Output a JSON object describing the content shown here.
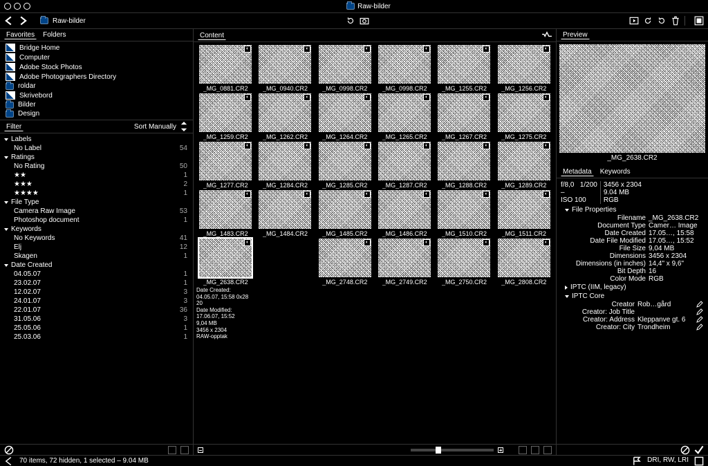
{
  "window_title": "Raw-bilder",
  "path_label": "Raw-bilder",
  "left": {
    "tabs": [
      "Favorites",
      "Folders"
    ],
    "fav_items": [
      {
        "label": "Bridge Home"
      },
      {
        "label": "Computer"
      },
      {
        "label": "Adobe Stock Photos"
      },
      {
        "label": "Adobe Photographers Directory"
      },
      {
        "label": "roldar"
      },
      {
        "label": "Skrivebord"
      },
      {
        "label": "Bilder"
      },
      {
        "label": "Design"
      }
    ],
    "filter_title": "Filter",
    "sort_label": "Sort Manually",
    "cats": [
      {
        "name": "Labels",
        "rows": [
          {
            "label": "No Label",
            "count": "54"
          }
        ]
      },
      {
        "name": "Ratings",
        "rows": [
          {
            "label": "No Rating",
            "count": "50"
          },
          {
            "label": "★★",
            "count": "1"
          },
          {
            "label": "★★★",
            "count": "2"
          },
          {
            "label": "★★★★",
            "count": "1"
          }
        ]
      },
      {
        "name": "File Type",
        "rows": [
          {
            "label": "Camera Raw Image",
            "count": "53"
          },
          {
            "label": "Photoshop document",
            "count": "1"
          }
        ]
      },
      {
        "name": "Keywords",
        "rows": [
          {
            "label": "No Keywords",
            "count": "41"
          },
          {
            "label": "Elj",
            "count": "12"
          },
          {
            "label": "Skagen",
            "count": "1"
          }
        ]
      },
      {
        "name": "Date Created",
        "rows": [
          {
            "label": "04.05.07",
            "count": "1"
          },
          {
            "label": "23.02.07",
            "count": "1"
          },
          {
            "label": "12.02.07",
            "count": "3"
          },
          {
            "label": "24.01.07",
            "count": "3"
          },
          {
            "label": "22.01.07",
            "count": "36"
          },
          {
            "label": "31.05.06",
            "count": "3"
          },
          {
            "label": "25.05.06",
            "count": "1"
          },
          {
            "label": "25.03.06",
            "count": "1"
          }
        ]
      }
    ]
  },
  "center": {
    "tab": "Content",
    "thumbs": [
      "_MG_0881.CR2",
      "_MG_0940.CR2",
      "_MG_0998.CR2",
      "_MG_0998.CR2",
      "_MG_1255.CR2",
      "_MG_1256.CR2",
      "_MG_1259.CR2",
      "_MG_1262.CR2",
      "_MG_1264.CR2",
      "_MG_1265.CR2",
      "_MG_1267.CR2",
      "_MG_1275.CR2",
      "_MG_1277.CR2",
      "_MG_1284.CR2",
      "_MG_1285.CR2",
      "_MG_1287.CR2",
      "_MG_1288.CR2",
      "_MG_1289.CR2",
      "_MG_1483.CR2",
      "_MG_1484.CR2",
      "_MG_1485.CR2",
      "_MG_1486.CR2",
      "_MG_1510.CR2",
      "_MG_1511.CR2",
      "_MG_2638.CR2",
      "",
      "_MG_2748.CR2",
      "_MG_2749.CR2",
      "_MG_2750.CR2",
      "_MG_2808.CR2"
    ],
    "sel": 24,
    "sel_meta": {
      "l2": "Date Created: 04.05.07, 15:58   0x28 20",
      "l3": "Date Modified: 17.06.07, 15:52",
      "l4": "9,04 MB",
      "l5": "3456 x 2304",
      "l6": "RAW-opptak"
    }
  },
  "right": {
    "preview_tab": "Preview",
    "preview_caption": "_MG_2638.CR2",
    "md_tabs": [
      "Metadata",
      "Keywords"
    ],
    "cam": {
      "f": "f/8,0",
      "sh": "1/200",
      "dim": "3456 x 2304",
      "wb": "–",
      "iso": "ISO 100",
      "size": "9.04 MB",
      "cs": "RGB"
    },
    "fp_title": "File Properties",
    "fp": [
      {
        "k": "Filename",
        "v": "_MG_2638.CR2"
      },
      {
        "k": "Document Type",
        "v": "Camer… Image"
      },
      {
        "k": "Date Created",
        "v": "17.05…, 15:58"
      },
      {
        "k": "Date File Modified",
        "v": "17.05…, 15:52"
      },
      {
        "k": "File Size",
        "v": "9,04 MB"
      },
      {
        "k": "Dimensions",
        "v": "3456 x 2304"
      },
      {
        "k": "Dimensions (in inches)",
        "v": "14,4\" x 9,6\""
      },
      {
        "k": "Bit Depth",
        "v": "16"
      },
      {
        "k": "Color Mode",
        "v": "RGB"
      }
    ],
    "iptc_legacy": "IPTC (IIM, legacy)",
    "iptc_core": "IPTC Core",
    "core": [
      {
        "k": "Creator",
        "v": "Rob…gård"
      },
      {
        "k": "Creator: Job Title",
        "v": ""
      },
      {
        "k": "Creator: Address",
        "v": "Kleppanve gt. 6"
      },
      {
        "k": "Creator: City",
        "v": "Trondheim"
      }
    ]
  },
  "status": {
    "text": "70 items, 72 hidden, 1 selected – 9.04 MB",
    "right": "DRI, RW, LRI"
  }
}
